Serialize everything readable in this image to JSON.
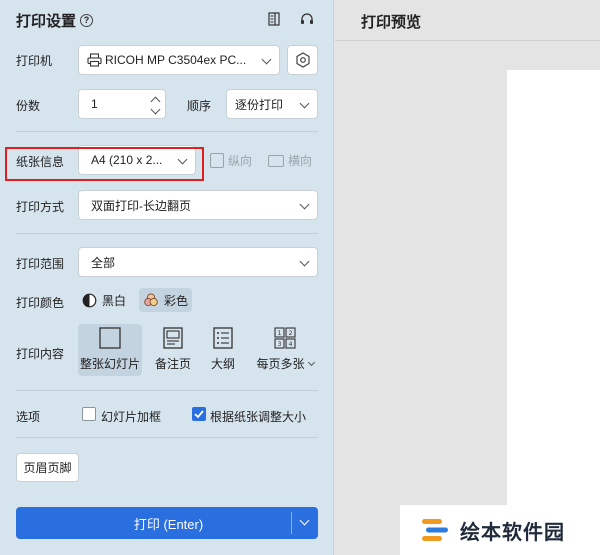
{
  "settings_panel": {
    "title": "打印设置",
    "printer": {
      "label": "打印机",
      "value": "RICOH MP C3504ex PC..."
    },
    "copies": {
      "label": "份数",
      "value": "1"
    },
    "order": {
      "label": "顺序",
      "value": "逐份打印"
    },
    "paper": {
      "label": "纸张信息",
      "value": "A4 (210 x 2...",
      "portrait_label": "纵向",
      "landscape_label": "横向"
    },
    "print_mode": {
      "label": "打印方式",
      "value": "双面打印-长边翻页"
    },
    "print_range": {
      "label": "打印范围",
      "value": "全部"
    },
    "print_color": {
      "label": "打印颜色",
      "options": [
        "黑白",
        "彩色"
      ],
      "selected": "彩色"
    },
    "print_content": {
      "label": "打印内容",
      "items": [
        "整张幻灯片",
        "备注页",
        "大纲",
        "每页多张"
      ],
      "selected": "整张幻灯片"
    },
    "options": {
      "label": "选项",
      "frame_slides_label": "幻灯片加框",
      "frame_slides_checked": false,
      "fit_paper_label": "根据纸张调整大小",
      "fit_paper_checked": true
    },
    "header_footer_label": "页眉页脚",
    "print_button_label": "打印 (Enter)"
  },
  "preview": {
    "title": "打印预览"
  },
  "watermark": {
    "text": "绘本软件园"
  },
  "colors": {
    "accent": "#2a6fe0",
    "highlight_box": "#e02020"
  }
}
